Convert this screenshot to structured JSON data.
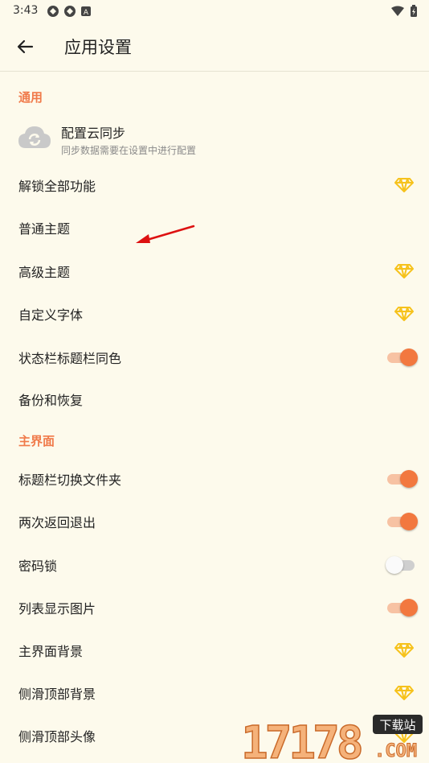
{
  "status_bar": {
    "time": "3:43",
    "left_icons": [
      "app-notification-icon",
      "app-notification-icon",
      "keyboard-icon"
    ],
    "right_icons": [
      "wifi-icon",
      "battery-icon"
    ]
  },
  "app_bar": {
    "back_icon": "arrow-back-icon",
    "title": "应用设置"
  },
  "colors": {
    "background": "#fdfaec",
    "accent": "#f2783f",
    "section_header": "#f07a4a",
    "premium_gem": "#f6c21c"
  },
  "sections": [
    {
      "header": "通用",
      "cloud_item": {
        "title": "配置云同步",
        "subtitle": "同步数据需要在设置中进行配置",
        "icon": "cloud-sync-icon"
      },
      "items": [
        {
          "label": "解锁全部功能",
          "control": "premium"
        },
        {
          "label": "普通主题",
          "control": "none"
        },
        {
          "label": "高级主题",
          "control": "premium"
        },
        {
          "label": "自定义字体",
          "control": "premium"
        },
        {
          "label": "状态栏标题栏同色",
          "control": "switch",
          "on": true
        },
        {
          "label": "备份和恢复",
          "control": "none"
        }
      ]
    },
    {
      "header": "主界面",
      "items": [
        {
          "label": "标题栏切换文件夹",
          "control": "switch",
          "on": true
        },
        {
          "label": "两次返回退出",
          "control": "switch",
          "on": true
        },
        {
          "label": "密码锁",
          "control": "switch",
          "on": false
        },
        {
          "label": "列表显示图片",
          "control": "switch",
          "on": true
        },
        {
          "label": "主界面背景",
          "control": "premium"
        },
        {
          "label": "侧滑顶部背景",
          "control": "premium"
        },
        {
          "label": "侧滑顶部头像",
          "control": "premium"
        }
      ]
    }
  ],
  "watermark": {
    "digits": "17178",
    "site_badge": "下载站",
    "domain": ".COM"
  }
}
